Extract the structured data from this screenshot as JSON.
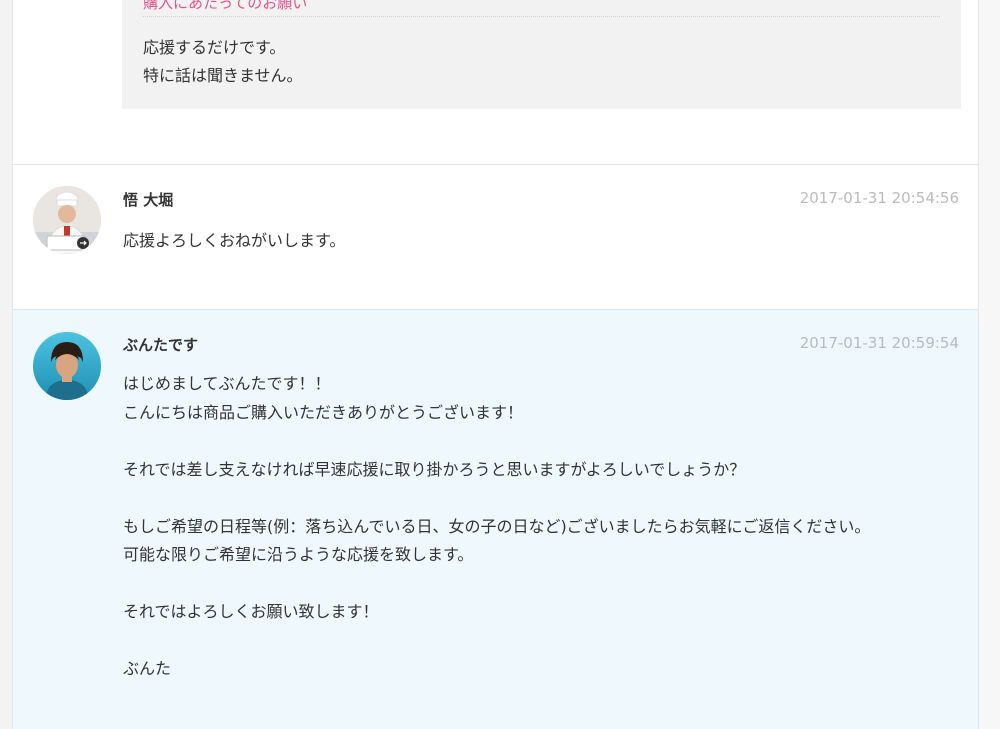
{
  "note": {
    "title": "購入にあたってのお願い",
    "body": "応援するだけです。\n特に話は聞きません。"
  },
  "comments": [
    {
      "author": "悟 大堀",
      "timestamp": "2017-01-31 20:54:56",
      "message": "応援よろしくおねがいします。",
      "avatar_icon": "chef-avatar-icon"
    },
    {
      "author": "ぶんたです",
      "timestamp": "2017-01-31 20:59:54",
      "message": "はじめましてぶんたです！！\nこんにちは商品ご購入いただきありがとうございます！\n\nそれでは差し支えなければ早速応援に取り掛かろうと思いますがよろしいでしょうか？\n\nもしご希望の日程等(例：落ち込んでいる日、女の子の日など)ございましたらお気軽にご返信ください。\n可能な限りご希望に沿うような応援を致します。\n\nそれではよろしくお願い致します！\n\nぶんた",
      "avatar_icon": "person-avatar-icon"
    }
  ],
  "colors": {
    "note_title": "#e8528a",
    "highlight_bg": "#eff8fc",
    "timestamp": "#bbbbbb"
  }
}
